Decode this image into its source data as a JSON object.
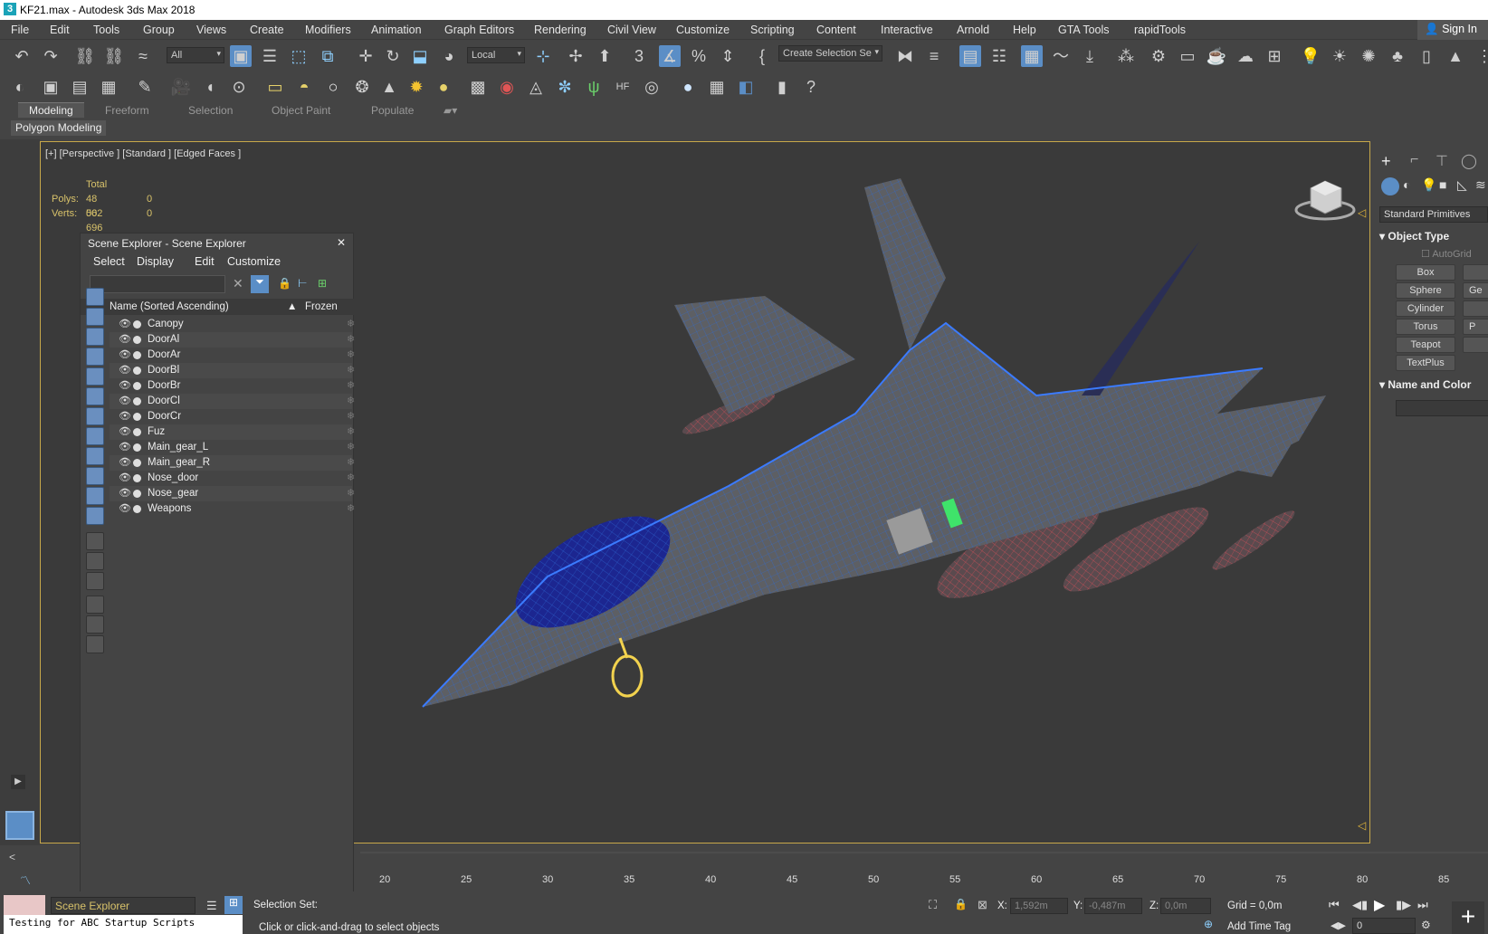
{
  "window": {
    "title": "KF21.max - Autodesk 3ds Max 2018",
    "logo": "3"
  },
  "menu": [
    "File",
    "Edit",
    "Tools",
    "Group",
    "Views",
    "Create",
    "Modifiers",
    "Animation",
    "Graph Editors",
    "Rendering",
    "Civil View",
    "Customize",
    "Scripting",
    "Content",
    "Interactive",
    "Arnold",
    "Help",
    "GTA Tools",
    "rapidTools"
  ],
  "signin": "Sign In",
  "toolbar": {
    "filter": "All",
    "coord": "Local",
    "selection_set": "Create Selection Se"
  },
  "ribbon": {
    "tabs": [
      "Modeling",
      "Freeform",
      "Selection",
      "Object Paint",
      "Populate"
    ],
    "active_tab": "Modeling",
    "panel": "Polygon Modeling"
  },
  "viewport": {
    "label": "[+] [Perspective ] [Standard ] [Edged Faces ]",
    "stats": {
      "header": "Total",
      "polys_label": "Polys:",
      "polys": "48 062",
      "polys_sel": "0",
      "verts_label": "Verts:",
      "verts": "50 696",
      "verts_sel": "0"
    }
  },
  "scene_explorer": {
    "title": "Scene Explorer - Scene Explorer",
    "menu": [
      "Select",
      "Display",
      "Edit",
      "Customize"
    ],
    "col_name": "Name (Sorted Ascending)",
    "col_frozen": "Frozen",
    "items": [
      "Canopy",
      "DoorAl",
      "DoorAr",
      "DoorBl",
      "DoorBr",
      "DoorCl",
      "DoorCr",
      "Fuz",
      "Main_gear_L",
      "Main_gear_R",
      "Nose_door",
      "Nose_gear",
      "Weapons"
    ]
  },
  "command_panel": {
    "category": "Standard Primitives",
    "object_type": "Object Type",
    "autogrid": "AutoGrid",
    "buttons": [
      "Box",
      "Sphere",
      "Cylinder",
      "Torus",
      "Teapot",
      "TextPlus"
    ],
    "buttons_right": [
      "",
      "Ge",
      "",
      "P",
      "",
      ""
    ],
    "name_color": "Name and Color"
  },
  "timeline": {
    "ticks": [
      "20",
      "25",
      "30",
      "35",
      "40",
      "45",
      "50",
      "55",
      "60",
      "65",
      "70",
      "75",
      "80",
      "85"
    ]
  },
  "status": {
    "scene_dropdown": "Scene Explorer",
    "selection_set": "Selection Set:",
    "prompt": "Click or click-and-drag to select objects",
    "script": "Testing for ABC Startup Scripts",
    "x_label": "X:",
    "x": "1,592m",
    "y_label": "Y:",
    "y": "-0,487m",
    "z_label": "Z:",
    "z": "0,0m",
    "grid": "Grid = 0,0m",
    "add_time_tag": "Add Time Tag",
    "frame": "0"
  }
}
